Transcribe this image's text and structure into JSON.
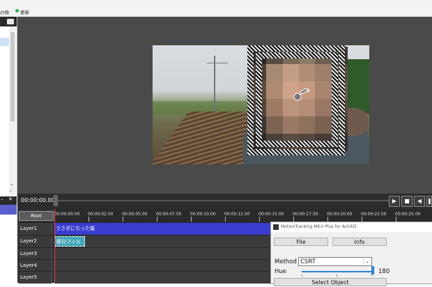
{
  "menu": {
    "item_other": "の他",
    "item_update": "更新"
  },
  "player": {
    "timecode": "00:00:00.00"
  },
  "timeline": {
    "root_label": "Root",
    "ruler_ticks": [
      "00:00:00.00",
      "00:00:02.50",
      "00:00:05.00",
      "00:00:07.50",
      "00:00:10.00",
      "00:00:12.50",
      "00:00:15.00",
      "00:00:17.50",
      "00:00:20.00",
      "00:00:22.50",
      "00:00:25.00"
    ],
    "layers": [
      {
        "name": "Layer1"
      },
      {
        "name": "Layer2"
      },
      {
        "name": "Layer3"
      },
      {
        "name": "Layer4"
      },
      {
        "name": "Layer5"
      }
    ],
    "clip1_label": "うさぎになった猫",
    "clip2_label": "部分フィルタ"
  },
  "plugin": {
    "title": "MotionTracking MK-II Plus for AviUtl2",
    "file_button": "File",
    "info_button": "Info",
    "method_label": "Method",
    "method_value": "CSRT",
    "hue_label": "Hue",
    "hue_value": "180",
    "select_object_button": "Select Object"
  },
  "colors": {
    "clip1": "#3a3ed0",
    "clip2": "#45a7b8",
    "accent": "#2a7fdb"
  },
  "icons": [
    "folder-icon",
    "play-icon",
    "stop-icon",
    "step-back-icon",
    "pause-icon",
    "tracking-target-icon",
    "app-icon",
    "dropdown-arrow-icon"
  ]
}
